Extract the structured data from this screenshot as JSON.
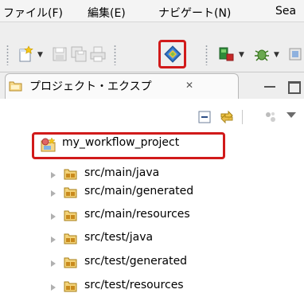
{
  "menubar": {
    "items": [
      "ファイル(F)",
      "編集(E)",
      "ナビゲート(N)",
      "Sea"
    ]
  },
  "toolbar": {
    "icons": [
      "new-wizard-icon",
      "save-icon",
      "save-all-icon",
      "print-icon",
      "workflow-editor-icon",
      "run-icon",
      "debug-icon"
    ]
  },
  "view": {
    "title": "プロジェクト・エクスプ",
    "close_glyph": "✕"
  },
  "tree": {
    "project": "my_workflow_project",
    "folders": [
      "src/main/java",
      "src/main/generated",
      "src/main/resources",
      "src/test/java",
      "src/test/generated",
      "src/test/resources"
    ]
  },
  "colors": {
    "highlight": "#d11a1a",
    "package_icon": "#c9a23a"
  }
}
